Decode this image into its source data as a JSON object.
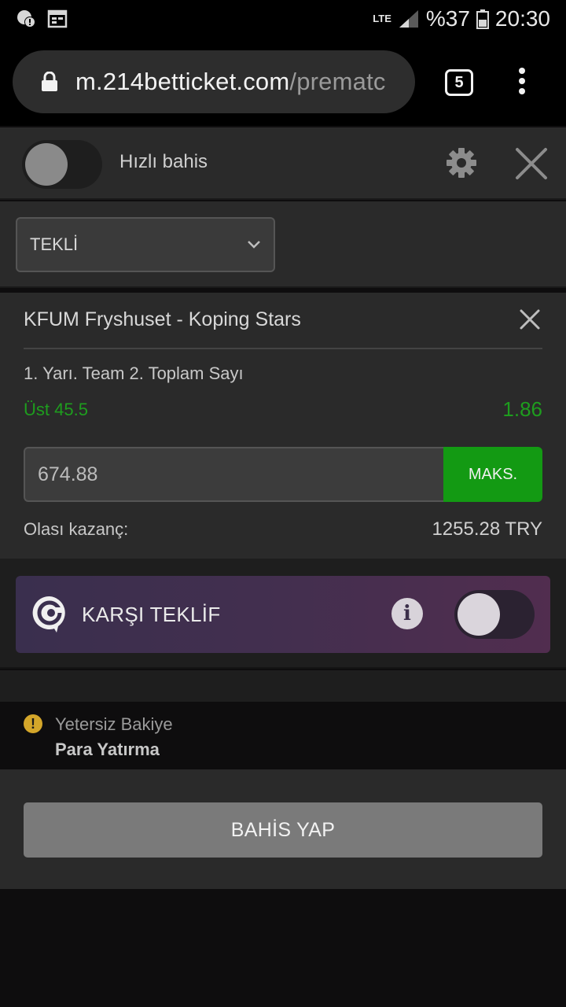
{
  "status_bar": {
    "network": "LTE",
    "battery": "%37",
    "time": "20:30",
    "icons": [
      "notification-alert-icon",
      "calendar-icon",
      "signal-icon",
      "battery-icon"
    ]
  },
  "browser": {
    "url_host": "m.214betticket.com",
    "url_path": "/prematc",
    "tabs_count": "5",
    "icons": [
      "lock-icon",
      "menu-dots-icon"
    ]
  },
  "quick_bet": {
    "label": "Hızlı bahis",
    "enabled": false
  },
  "bet_type": {
    "selected": "TEKLİ"
  },
  "selection": {
    "match": "KFUM Fryshuset - Koping Stars",
    "market": "1. Yarı. Team 2. Toplam Sayı",
    "pick": "Üst 45.5",
    "odds": "1.86",
    "stake": "674.88",
    "max_label": "MAKS.",
    "payout_label": "Olası kazanç:",
    "payout_value": "1255.28 TRY"
  },
  "counter_offer": {
    "label": "KARŞI TEKLİF",
    "enabled": false
  },
  "balance": {
    "message": "Yetersiz Bakiye",
    "deposit_label": "Para Yatırma"
  },
  "actions": {
    "place_bet_label": "BAHİS YAP"
  },
  "colors": {
    "accent_green": "#139a13",
    "odds_green": "#1e9d1e",
    "warning": "#d4a62a"
  }
}
